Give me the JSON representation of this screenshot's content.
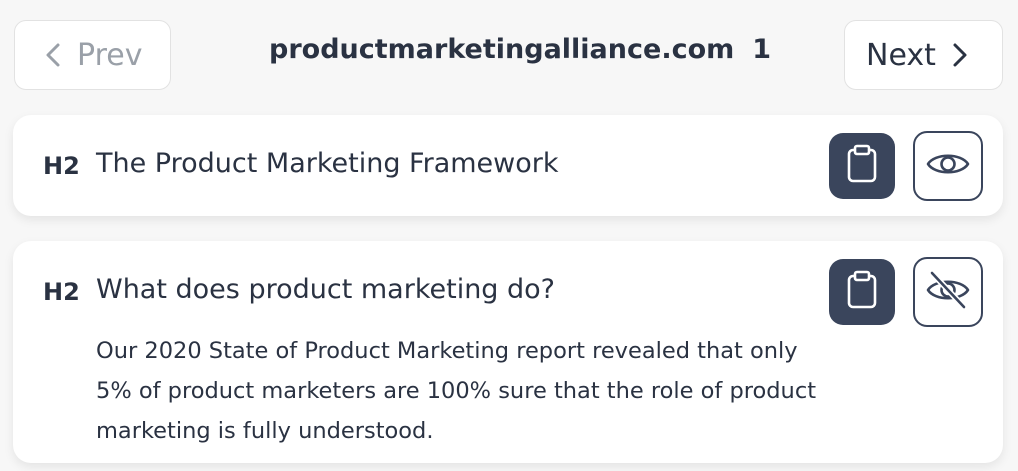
{
  "nav": {
    "prev_label": "Prev",
    "next_label": "Next",
    "prev_icon": "chevron-left-icon",
    "next_icon": "chevron-right-icon"
  },
  "site": {
    "domain": "productmarketingalliance.com",
    "count": "1"
  },
  "headings": [
    {
      "tag": "H2",
      "text": "The Product Marketing Framework",
      "visible": true,
      "copy_icon": "clipboard-icon",
      "visibility_icon": "eye-icon"
    },
    {
      "tag": "H2",
      "text": "What does product marketing do?",
      "body": "Our 2020 State of Product Marketing report revealed that only 5% of product marketers are 100% sure that the role of product marketing is fully understood.",
      "visible": false,
      "copy_icon": "clipboard-icon",
      "visibility_icon": "eye-off-icon"
    }
  ],
  "colors": {
    "background": "#f7f7f7",
    "card": "#ffffff",
    "accent_dark": "#3a455c",
    "text": "#2a3242",
    "muted": "#9aa0a8"
  }
}
